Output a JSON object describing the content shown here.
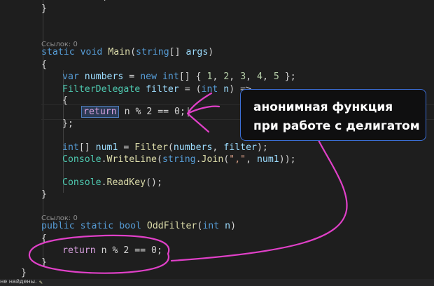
{
  "codelens": {
    "main": "Ссылок: 0",
    "odd": "Ссылок: 0"
  },
  "code": {
    "l_close_top": "}",
    "static": "static",
    "void": "void",
    "main": "Main",
    "string": "string",
    "args": "args",
    "brace_open": "{",
    "var": "var",
    "numbers": "numbers",
    "new": "new",
    "int": "int",
    "one": "1",
    "two": "2",
    "three": "3",
    "four": "4",
    "five": "5",
    "filter_delegate": "FilterDelegate",
    "filter": "filter",
    "n": "n",
    "return": "return",
    "mod_expr": "n % 2 == 0;",
    "mod_expr_close": "n % 2 == 0;",
    "closing_brace_semicolon": "};",
    "num1": "num1",
    "filter_method": "Filter",
    "console": "Console",
    "writeline": "WriteLine",
    "join": "Join",
    "comma_str": "\",\"",
    "readkey": "ReadKey",
    "public": "public",
    "bool": "bool",
    "oddfilter": "OddFilter",
    "brace_close": "}"
  },
  "callout": {
    "line1": "анонимная функция",
    "line2": "при работе с делигатом"
  },
  "statusbar": {
    "text": "не найдены."
  },
  "colors": {
    "background": "#1e1e1e",
    "annotation": "#e040c8",
    "callout_border": "#3c6fd6"
  }
}
